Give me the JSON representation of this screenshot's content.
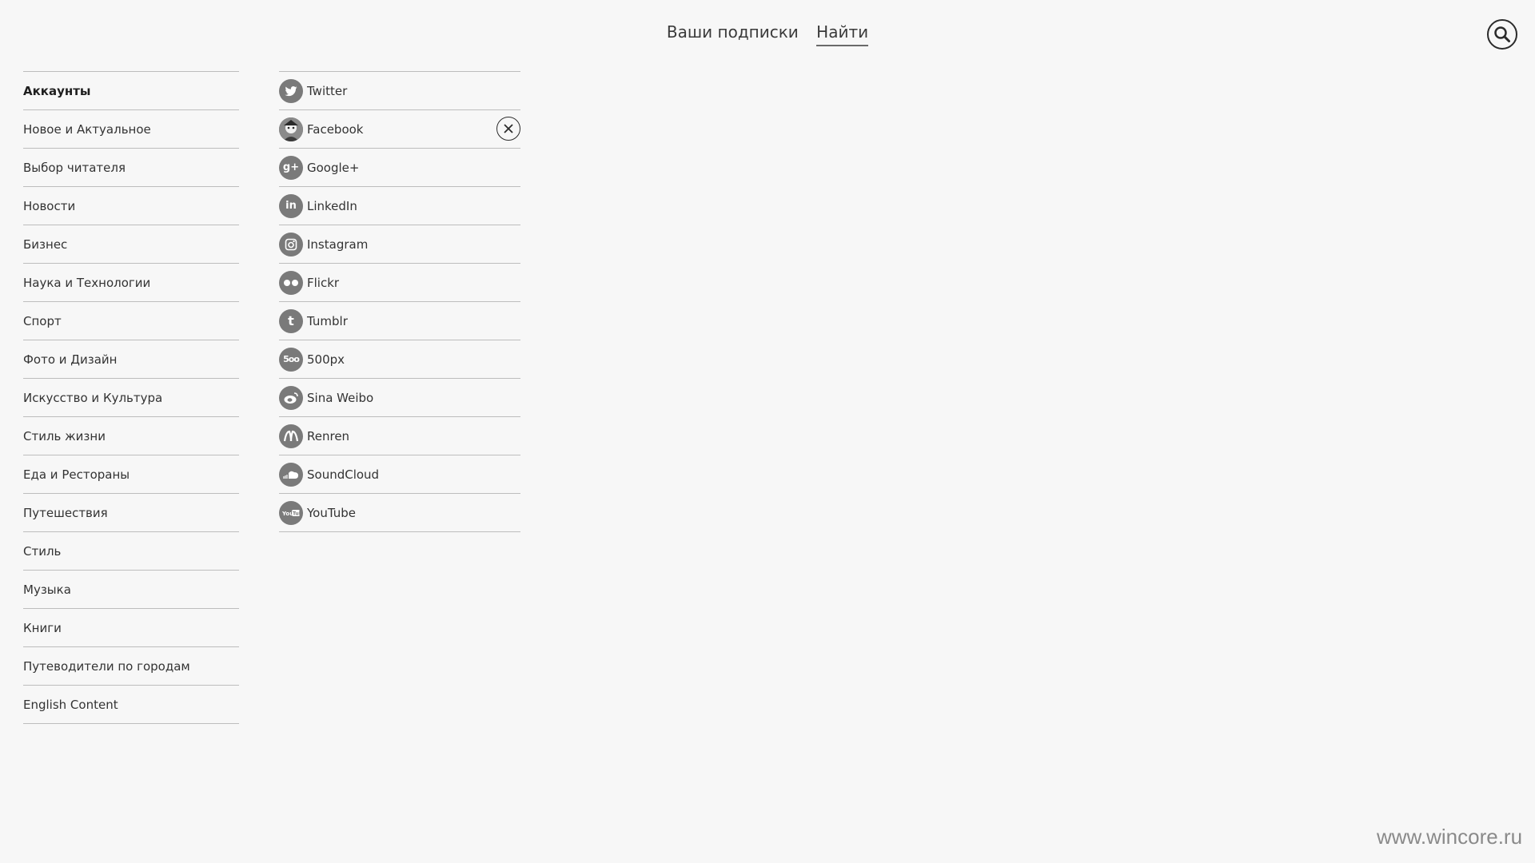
{
  "nav": {
    "tabs": [
      {
        "label": "Ваши подписки"
      },
      {
        "label": "Найти"
      }
    ]
  },
  "search": {
    "icon": "search-icon"
  },
  "categories": [
    {
      "label": "Аккаунты"
    },
    {
      "label": "Новое и Актуальное"
    },
    {
      "label": "Выбор читателя"
    },
    {
      "label": "Новости"
    },
    {
      "label": "Бизнес"
    },
    {
      "label": "Наука и Технологии"
    },
    {
      "label": "Спорт"
    },
    {
      "label": "Фото и Дизайн"
    },
    {
      "label": "Искусство и Культура"
    },
    {
      "label": "Стиль жизни"
    },
    {
      "label": "Еда и Рестораны"
    },
    {
      "label": "Путешествия"
    },
    {
      "label": "Стиль"
    },
    {
      "label": "Музыка"
    },
    {
      "label": "Книги"
    },
    {
      "label": "Путеводители по городам"
    },
    {
      "label": "English Content"
    }
  ],
  "accounts": [
    {
      "label": "Twitter",
      "icon": "twitter-icon"
    },
    {
      "label": "Facebook",
      "icon": "avatar-icon"
    },
    {
      "label": "Google+",
      "icon": "google-plus-icon"
    },
    {
      "label": "LinkedIn",
      "icon": "linkedin-icon"
    },
    {
      "label": "Instagram",
      "icon": "instagram-icon"
    },
    {
      "label": "Flickr",
      "icon": "flickr-icon"
    },
    {
      "label": "Tumblr",
      "icon": "tumblr-icon"
    },
    {
      "label": "500px",
      "icon": "500px-icon"
    },
    {
      "label": "Sina Weibo",
      "icon": "weibo-icon"
    },
    {
      "label": "Renren",
      "icon": "renren-icon"
    },
    {
      "label": "SoundCloud",
      "icon": "soundcloud-icon"
    },
    {
      "label": "YouTube",
      "icon": "youtube-icon"
    }
  ],
  "watermark": "www.wincore.ru",
  "colors": {
    "background": "#f7f7f7",
    "divider": "#bdbdbd",
    "icon_bg": "#7a7a7a",
    "text": "#2b2b2b"
  }
}
